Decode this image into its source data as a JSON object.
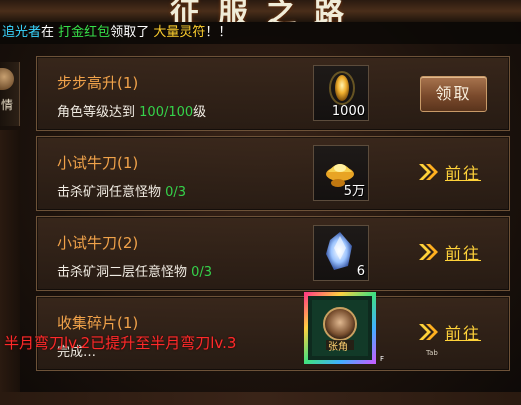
{
  "header": {
    "title": "征服之路"
  },
  "broadcast": {
    "player": "追光者",
    "connector": "在",
    "event": "打金红包",
    "verb": "领取了",
    "reward": "大量灵符",
    "suffix": "！！"
  },
  "side_tab": {
    "label": "情"
  },
  "quests": [
    {
      "name": "步步高升(1)",
      "desc": "角色等级达到",
      "progress": "100/100",
      "desc_suffix": "级",
      "reward_icon": "gold-ingot-icon",
      "reward_count": "1000",
      "action": "领取"
    },
    {
      "name": "小试牛刀(1)",
      "desc": "击杀矿洞任意怪物",
      "progress": "0/3",
      "reward_icon": "gold-yuanbao-icon",
      "reward_count": "5万",
      "action": "前往"
    },
    {
      "name": "小试牛刀(2)",
      "desc": "击杀矿洞二层任意怪物",
      "progress": "0/3",
      "reward_icon": "crystal-icon",
      "reward_count": "6",
      "action": "前往"
    },
    {
      "name": "收集碎片(1)",
      "desc": "完成…",
      "reward_icon": "warrior-portrait-icon",
      "reward_label": "张角",
      "action": "前往"
    }
  ],
  "overlay_message": "半月弯刀lv.2已提升至半月弯刀lv.3",
  "hints": {
    "tab": "Tab",
    "f_key": "F"
  },
  "colors": {
    "quest_name": "#f0a24a",
    "progress": "#35d24a",
    "goto": "#ffd23a",
    "overlay": "#ff2a2a"
  }
}
